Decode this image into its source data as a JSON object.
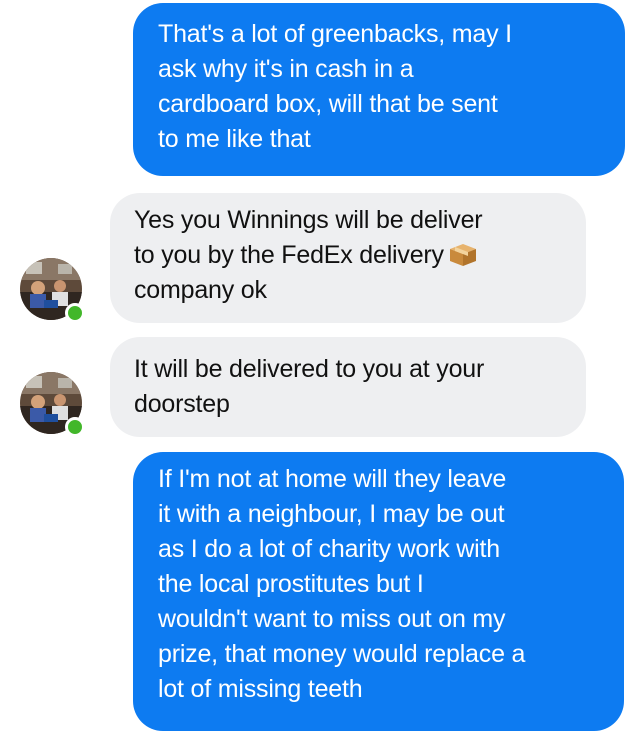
{
  "conversation": {
    "messages": [
      {
        "sender": "me",
        "text": "That's a lot of greenbacks, may I\nask why it's in cash in a\ncardboard box, will that be sent\nto me like that"
      },
      {
        "sender": "other",
        "text_main": "Yes you Winnings will be deliver\nto you by the FedEx delivery",
        "emoji": "package-icon",
        "text_after": "company ok"
      },
      {
        "sender": "other",
        "text": "It will be delivered to you at your\ndoorstep"
      },
      {
        "sender": "me",
        "text": "If I'm not at home will they leave\nit with a neighbour, I may be out\nas I do a lot of charity work with\nthe local prostitutes but I\nwouldn't want to miss out on my\nprize, that money would replace a\nlot of missing teeth"
      }
    ]
  },
  "colors": {
    "outgoing_bubble": "#0d7bf1",
    "incoming_bubble": "#eeeff1",
    "online_indicator": "#42b72a"
  }
}
